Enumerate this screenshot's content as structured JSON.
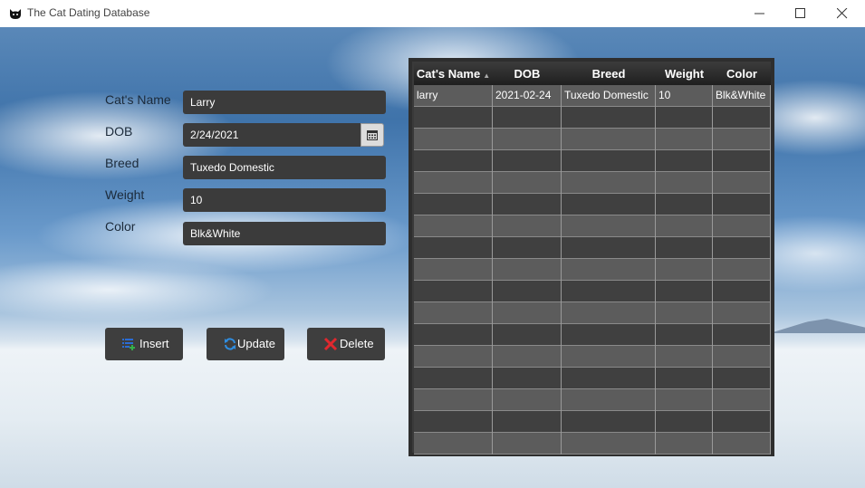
{
  "window": {
    "title": "The Cat Dating Database",
    "icon": "cat-icon"
  },
  "form": {
    "name_label": "Cat's Name",
    "name_value": "Larry",
    "dob_label": "DOB",
    "dob_value": "2/24/2021",
    "breed_label": "Breed",
    "breed_value": "Tuxedo Domestic",
    "weight_label": "Weight",
    "weight_value": "10",
    "color_label": "Color",
    "color_value": "Blk&White"
  },
  "buttons": {
    "insert": "Insert",
    "update": "Update",
    "delete": "Delete"
  },
  "table": {
    "columns": [
      "Cat's Name",
      "DOB",
      "Breed",
      "Weight",
      "Color"
    ],
    "sorted_column": "Cat's Name",
    "rows": [
      [
        "larry",
        "2021-02-24",
        "Tuxedo Domestic",
        "10",
        "Blk&White"
      ]
    ]
  },
  "colors": {
    "field_bg": "#3b3b3b",
    "button_bg": "#3e3e3e",
    "insert_icon": "#2b6cd4",
    "update_icon": "#2f8de0",
    "delete_icon": "#e0282e"
  }
}
